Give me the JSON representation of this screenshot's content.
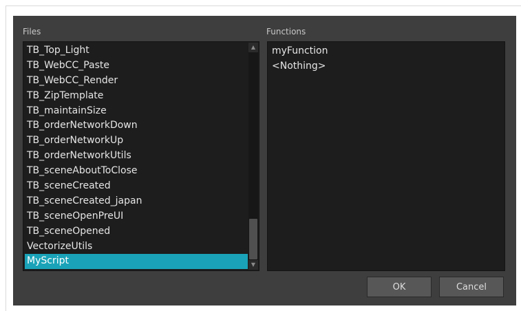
{
  "files": {
    "label": "Files",
    "items": [
      "TB_Top_Light",
      "TB_WebCC_Paste",
      "TB_WebCC_Render",
      "TB_ZipTemplate",
      "TB_maintainSize",
      "TB_orderNetworkDown",
      "TB_orderNetworkUp",
      "TB_orderNetworkUtils",
      "TB_sceneAboutToClose",
      "TB_sceneCreated",
      "TB_sceneCreated_japan",
      "TB_sceneOpenPreUI",
      "TB_sceneOpened",
      "VectorizeUtils",
      "MyScript"
    ],
    "selected": "MyScript",
    "scroll_up_icon": "▲",
    "scroll_down_icon": "▼"
  },
  "functions": {
    "label": "Functions",
    "items": [
      "myFunction",
      "<Nothing>"
    ]
  },
  "buttons": {
    "ok": "OK",
    "cancel": "Cancel"
  },
  "colors": {
    "dialog_bg": "#3e3e3e",
    "list_bg": "#1d1d1d",
    "selection": "#1aa3b8"
  }
}
